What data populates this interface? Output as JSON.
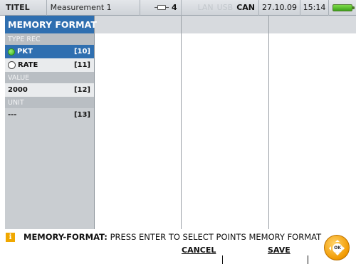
{
  "status": {
    "title": "TITEL",
    "file": "Measurement 1",
    "channel_count": "4",
    "lan": "LAN",
    "usb": "USB",
    "can": "CAN",
    "date": "27.10.09",
    "time": "15:14"
  },
  "panel": {
    "title": "MEMORY FORMAT",
    "type_rec_label": "TYPE REC",
    "options": [
      {
        "label": "PKT",
        "key": "[10]",
        "selected": true
      },
      {
        "label": "RATE",
        "key": "[11]",
        "selected": false
      }
    ],
    "value_label": "VALUE",
    "value": "2000",
    "value_key": "[12]",
    "unit_label": "UNIT",
    "unit": "---",
    "unit_key": "[13]"
  },
  "message": {
    "icon": "i",
    "title": "MEMORY-FORMAT:",
    "text": " PRESS ENTER TO SELECT POINTS MEMORY FORMAT"
  },
  "softkeys": {
    "cancel": "CANCEL",
    "save": "SAVE"
  },
  "ok_button": "OK",
  "colors": {
    "accent": "#2f6fb0",
    "selected_radio": "#35b11c",
    "battery": "#3da21a",
    "ok_button": "#f29a00"
  }
}
